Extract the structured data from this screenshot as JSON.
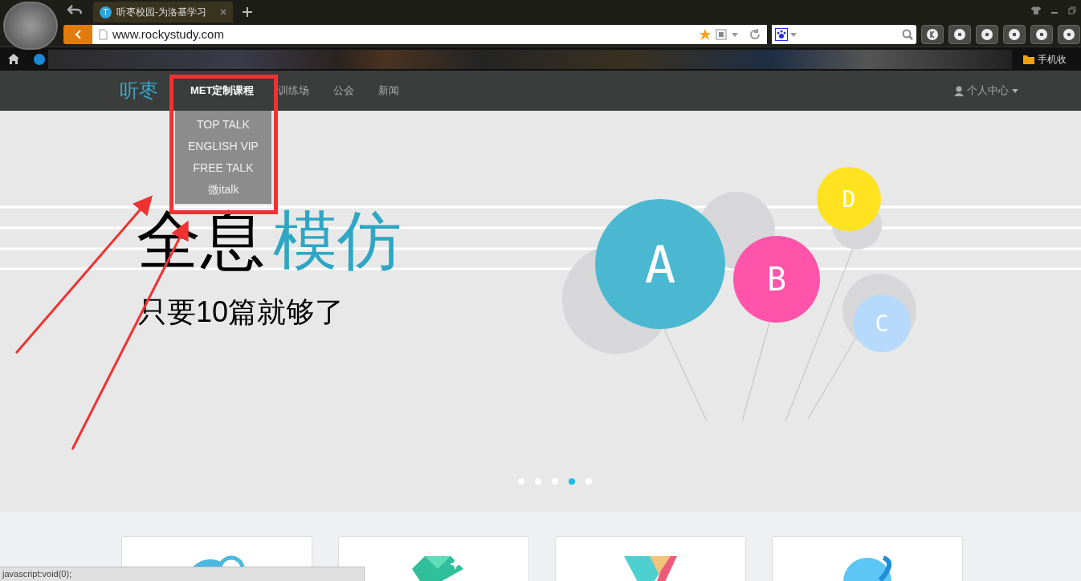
{
  "browser": {
    "tab": {
      "icon_letter": "T",
      "title": "听枣校园-为洛基学习",
      "selected": true
    },
    "address": {
      "value": "www.rockystudy.com"
    },
    "bookmarks": {
      "folder": "手机收"
    },
    "status": "javascript:void(0);"
  },
  "nav": {
    "logo": "听枣",
    "items": [
      {
        "label": "MET定制课程",
        "selected": true
      },
      {
        "label": "训练场",
        "selected": false
      },
      {
        "label": "公会",
        "selected": false
      },
      {
        "label": "新闻",
        "selected": false
      }
    ],
    "user": "个人中心",
    "dropdown": [
      "TOP TALK",
      "ENGLISH VIP",
      "FREE TALK",
      "微italk"
    ]
  },
  "hero": {
    "title_black": "全息",
    "title_blue": "模仿",
    "subtitle": "只要10篇就够了",
    "balloons": [
      {
        "letter": "A",
        "color": "#4bb8d1"
      },
      {
        "letter": "B",
        "color": "#ff54a9"
      },
      {
        "letter": "D",
        "color": "#ffe320"
      },
      {
        "letter": "C",
        "color": "#b7d9fb"
      }
    ],
    "dots": [
      {
        "selected": false
      },
      {
        "selected": false
      },
      {
        "selected": false
      },
      {
        "selected": true
      },
      {
        "selected": false
      }
    ]
  },
  "cards": [
    {
      "kind": "bubble"
    },
    {
      "kind": "gem"
    },
    {
      "kind": "prism"
    },
    {
      "kind": "planet"
    }
  ]
}
